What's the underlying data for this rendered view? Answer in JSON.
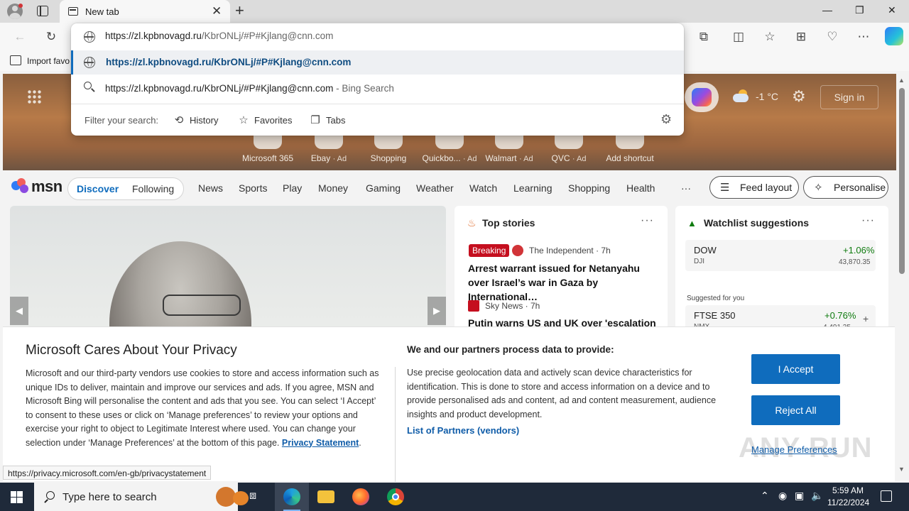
{
  "browser": {
    "tab_title": "New tab",
    "tab_close_icon": "✕",
    "new_tab_icon": "+",
    "window_controls": {
      "minimize": "—",
      "maximize": "❐",
      "close": "✕"
    },
    "bookmark_label": "Import favo"
  },
  "omnibox": {
    "input": {
      "host": "https://zl.kpbnovagd.ru",
      "rest": "/KbrONLj/#P#Kjlang@cnn.com"
    },
    "selected_suggestion": "https://zl.kpbnovagd.ru/KbrONLj/#P#Kjlang@cnn.com",
    "search_suggestion": {
      "query": "https://zl.kpbnovagd.ru/KbrONLj/#P#Kjlang@cnn.com",
      "suffix": " - Bing Search"
    },
    "filter_label": "Filter your search:",
    "filters": [
      {
        "icon": "history-icon",
        "glyph": "⟲",
        "label": "History"
      },
      {
        "icon": "star-icon",
        "glyph": "☆",
        "label": "Favorites"
      },
      {
        "icon": "tabs-icon",
        "glyph": "❐",
        "label": "Tabs"
      }
    ]
  },
  "hero": {
    "temperature": "-1 °C",
    "sign_in": "Sign in",
    "shortcuts": [
      {
        "label": "Microsoft 365",
        "ad": ""
      },
      {
        "label": "Ebay",
        "ad": "· Ad"
      },
      {
        "label": "Shopping",
        "ad": ""
      },
      {
        "label": "Quickbo...",
        "ad": "· Ad"
      },
      {
        "label": "Walmart",
        "ad": "· Ad"
      },
      {
        "label": "QVC",
        "ad": "· Ad"
      },
      {
        "label": "Add shortcut",
        "ad": ""
      }
    ]
  },
  "msn": {
    "logo_text": "msn",
    "segments": [
      "Discover",
      "Following"
    ],
    "nav": [
      "News",
      "Sports",
      "Play",
      "Money",
      "Gaming",
      "Weather",
      "Watch",
      "Learning",
      "Shopping",
      "Health"
    ],
    "more": "···",
    "feed_layout": "Feed layout",
    "personalise": "Personalise"
  },
  "top_stories": {
    "title": "Top stories",
    "more": "···",
    "stories": [
      {
        "badge": "Breaking",
        "source": "The Independent · 7h",
        "headline": "Arrest warrant issued for Netanyahu over Israel’s war in Gaza by International…"
      },
      {
        "badge": "",
        "source": "Sky News · 7h",
        "headline": "Putin warns US and UK over 'escalation"
      }
    ]
  },
  "watchlist": {
    "title": "Watchlist suggestions",
    "more": "···",
    "suggested_label": "Suggested for you",
    "stocks": [
      {
        "symbol": "DOW",
        "sub": "DJI",
        "change": "+1.06%",
        "value": "43,870.35"
      },
      {
        "symbol": "FTSE 350",
        "sub": "NMX",
        "change": "+0.76%",
        "value": "4,491.35"
      }
    ]
  },
  "privacy": {
    "title": "Microsoft Cares About Your Privacy",
    "body": "Microsoft and our third-party vendors use cookies to store and access information such as unique IDs to deliver, maintain and improve our services and ads. If you agree, MSN and Microsoft Bing will personalise the content and ads that you see. You can select ‘I Accept’ to consent to these uses or click on ‘Manage preferences’ to review your options and exercise your right to object to Legitimate Interest where used.  You can change your selection under ‘Manage Preferences’ at the bottom of this page.",
    "statement_link": "Privacy Statement",
    "statement_tail": ".",
    "partners_heading": "We and our partners process data to provide:",
    "partners_body": "Use precise geolocation data and actively scan device characteristics for identification. This is done to store and access information on a device and to provide personalised ads and content, ad and content measurement, audience insights and product development.",
    "partners_link": "List of Partners (vendors)",
    "accept": "I Accept",
    "reject": "Reject All",
    "manage": "Manage Preferences"
  },
  "watermark": "ANY RUN",
  "status_url": "https://privacy.microsoft.com/en-gb/privacystatement",
  "taskbar": {
    "search_placeholder": "Type here to search",
    "time": "5:59 AM",
    "date": "11/22/2024"
  },
  "colors": {
    "accent": "#0f6cbd",
    "breaking": "#c50f1f",
    "stock_up": "#0f7b0f",
    "taskbar": "#1f2a3a"
  }
}
